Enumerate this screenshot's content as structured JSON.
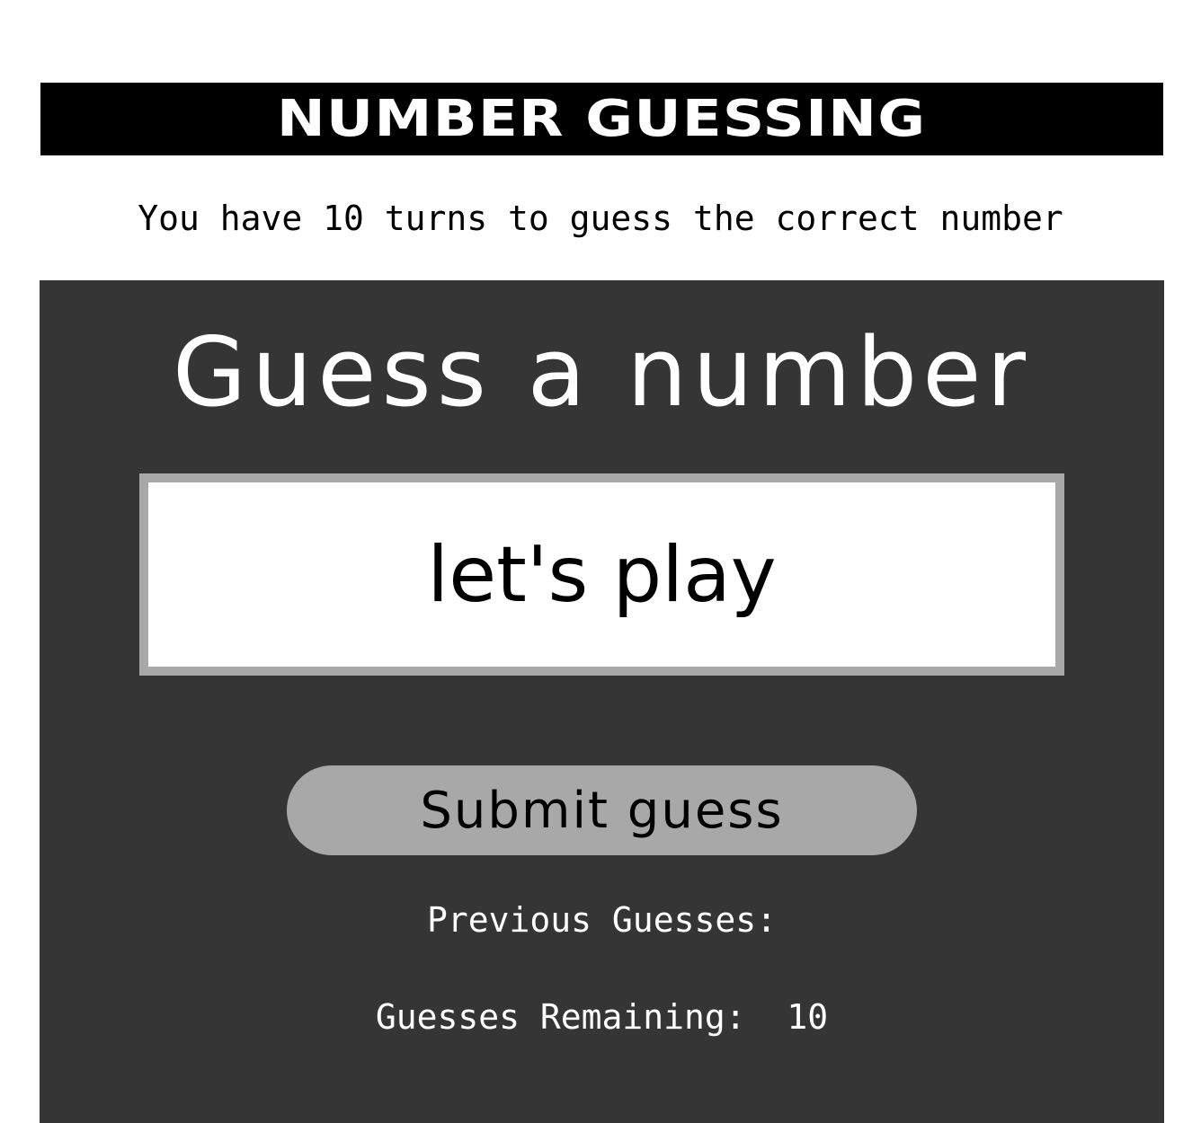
{
  "header": {
    "title": "NUMBER GUESSING"
  },
  "instructions": "You have 10 turns to guess the correct number",
  "game": {
    "title": "Guess a number",
    "input": {
      "placeholder": "let's play",
      "value": ""
    },
    "submit_label": "Submit guess",
    "previous_guesses_label": "Previous Guesses:",
    "previous_guesses_value": "",
    "remaining_label": "Guesses Remaining:",
    "remaining_value": "10"
  },
  "colors": {
    "header_bg": "#000000",
    "panel_bg": "#353535",
    "input_border": "#a8a8a8",
    "button_bg": "#a8a8a8",
    "text_light": "#ffffff",
    "text_dark": "#000000"
  }
}
